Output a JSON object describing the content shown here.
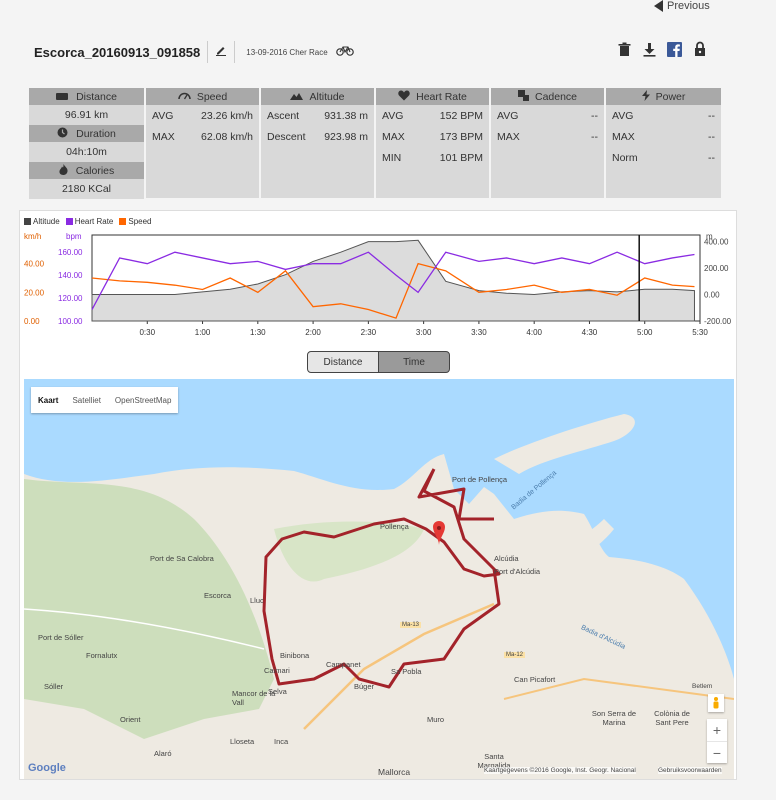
{
  "nav": {
    "previous_label": "Previous"
  },
  "activity": {
    "title": "Escorca_20160913_091858",
    "date": "13-09-2016 Cher Race",
    "icons": [
      "edit-icon",
      "bicycle-icon"
    ],
    "actions": [
      "trash-icon",
      "download-icon",
      "facebook-icon",
      "lock-icon"
    ]
  },
  "summary": {
    "distance_label": "Distance",
    "distance_value": "96.91 km",
    "duration_label": "Duration",
    "duration_value": "04h:10m",
    "calories_label": "Calories",
    "calories_value": "2180 KCal"
  },
  "stats": {
    "speed": {
      "label": "Speed",
      "rows": [
        [
          "AVG",
          "23.26 km/h"
        ],
        [
          "MAX",
          "62.08 km/h"
        ]
      ]
    },
    "altitude": {
      "label": "Altitude",
      "rows": [
        [
          "Ascent",
          "931.38 m"
        ],
        [
          "Descent",
          "923.98 m"
        ]
      ]
    },
    "heart_rate": {
      "label": "Heart Rate",
      "rows": [
        [
          "AVG",
          "152 BPM"
        ],
        [
          "MAX",
          "173 BPM"
        ],
        [
          "MIN",
          "101 BPM"
        ]
      ]
    },
    "cadence": {
      "label": "Cadence",
      "rows": [
        [
          "AVG",
          "--"
        ],
        [
          "MAX",
          "--"
        ]
      ]
    },
    "power": {
      "label": "Power",
      "rows": [
        [
          "AVG",
          "--"
        ],
        [
          "MAX",
          "--"
        ],
        [
          "Norm",
          "--"
        ]
      ]
    }
  },
  "chart_data": {
    "type": "line",
    "legend": [
      "Altitude",
      "Heart Rate",
      "Speed"
    ],
    "colors": {
      "Altitude": "#555555",
      "Heart Rate": "#8a2be2",
      "Speed": "#ff6600"
    },
    "units": {
      "speed": "km/h",
      "heart_rate": "bpm",
      "altitude": "m"
    },
    "speed_ticks": [
      "0.00",
      "20.00",
      "40.00"
    ],
    "hr_ticks": [
      "100.00",
      "120.00",
      "140.00",
      "160.00"
    ],
    "alt_ticks": [
      "-200.00",
      "0.00",
      "200.00",
      "400.00"
    ],
    "x_ticks": [
      "0:30",
      "1:00",
      "1:30",
      "2:00",
      "2:30",
      "3:00",
      "3:30",
      "4:00",
      "4:30",
      "5:00",
      "5:30"
    ],
    "x_hours": [
      0,
      0.25,
      0.5,
      0.75,
      1.0,
      1.25,
      1.5,
      1.75,
      2.0,
      2.25,
      2.5,
      2.75,
      2.95,
      3.2,
      3.5,
      3.75,
      4.0,
      4.25,
      4.5,
      4.75,
      5.0,
      5.25,
      5.45
    ],
    "series": [
      {
        "name": "Altitude",
        "values": [
          0,
          0,
          0,
          0,
          20,
          40,
          80,
          150,
          250,
          320,
          400,
          400,
          410,
          100,
          30,
          10,
          0,
          20,
          30,
          20,
          40,
          40,
          30
        ]
      },
      {
        "name": "Heart Rate",
        "values": [
          110,
          155,
          150,
          160,
          155,
          150,
          152,
          145,
          150,
          150,
          160,
          140,
          125,
          160,
          152,
          155,
          150,
          155,
          150,
          160,
          150,
          155,
          158
        ]
      },
      {
        "name": "Speed",
        "values": [
          30,
          28,
          27,
          25,
          22,
          30,
          20,
          35,
          10,
          12,
          8,
          2,
          40,
          35,
          20,
          22,
          25,
          20,
          22,
          18,
          30,
          25,
          24
        ]
      }
    ]
  },
  "toggle": {
    "distance": "Distance",
    "time": "Time"
  },
  "map": {
    "controls": [
      "Kaart",
      "Satelliet",
      "OpenStreetMap"
    ],
    "labels": [
      "Port de Pollença",
      "Pollença",
      "Badia de Pollença",
      "Alcúdia",
      "Port d'Alcúdia",
      "Badia d'Alcúdia",
      "Port de Sa Calobra",
      "Escorca",
      "Lluc",
      "Port de Sóller",
      "Fornalutx",
      "Sóller",
      "Binibona",
      "Caimari",
      "Campanet",
      "Selva",
      "Mancor de la Vall",
      "Búger",
      "Sa Pobla",
      "Can Picafort",
      "Son Serra de Marina",
      "Colònia de Sant Pere",
      "Inca",
      "Lloseta",
      "Orient",
      "Alaró",
      "Muro",
      "Santa Margalida",
      "Mallorca",
      "Ma-13",
      "Ma-12",
      "Betlem"
    ],
    "attribution": "Kaartgegevens ©2016 Google, Inst. Geogr. Nacional",
    "terms": "Gebruiksvoorwaarden",
    "google": "Google",
    "zoom_in": "+",
    "zoom_out": "−"
  }
}
